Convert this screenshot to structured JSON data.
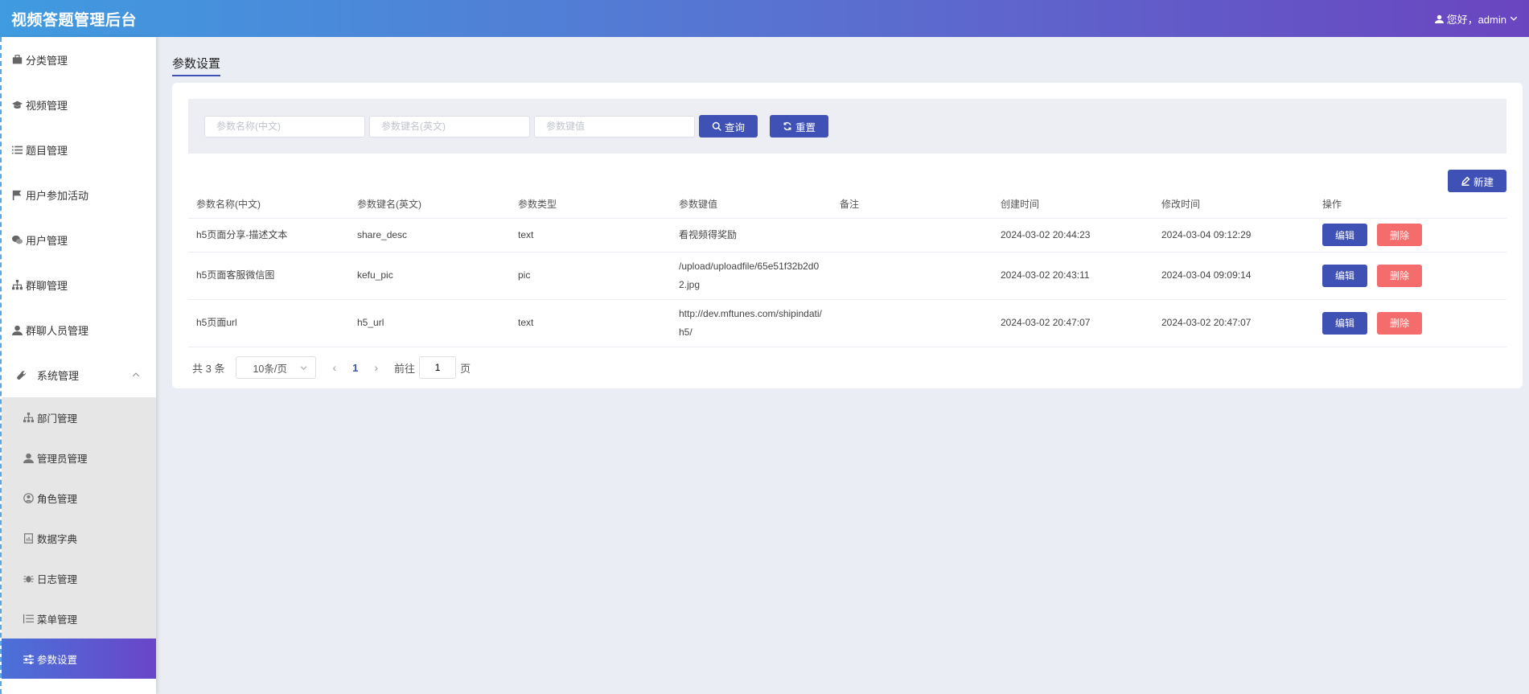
{
  "header": {
    "title": "视频答题管理后台",
    "greeting": "您好，admin"
  },
  "sidebar": {
    "items": [
      {
        "label": "分类管理"
      },
      {
        "label": "视频管理"
      },
      {
        "label": "题目管理"
      },
      {
        "label": "用户参加活动"
      },
      {
        "label": "用户管理"
      },
      {
        "label": "群聊管理"
      },
      {
        "label": "群聊人员管理"
      }
    ],
    "system": {
      "label": "系统管理",
      "children": [
        {
          "label": "部门管理"
        },
        {
          "label": "管理员管理"
        },
        {
          "label": "角色管理"
        },
        {
          "label": "数据字典"
        },
        {
          "label": "日志管理"
        },
        {
          "label": "菜单管理"
        },
        {
          "label": "参数设置"
        }
      ]
    }
  },
  "page": {
    "title": "参数设置"
  },
  "search": {
    "name_placeholder": "参数名称(中文)",
    "key_placeholder": "参数键名(英文)",
    "value_placeholder": "参数键值",
    "search_label": "查询",
    "reset_label": "重置"
  },
  "new_label": "新建",
  "table": {
    "headers": [
      "参数名称(中文)",
      "参数键名(英文)",
      "参数类型",
      "参数键值",
      "备注",
      "创建时间",
      "修改时间",
      "操作"
    ],
    "rows": [
      {
        "name": "h5页面分享-描述文本",
        "key": "share_desc",
        "type": "text",
        "value": "看视频得奖励",
        "remark": "",
        "created": "2024-03-02 20:44:23",
        "modified": "2024-03-04 09:12:29"
      },
      {
        "name": "h5页面客服微信图",
        "key": "kefu_pic",
        "type": "pic",
        "value": "/upload/uploadfile/65e51f32b2d02.jpg",
        "remark": "",
        "created": "2024-03-02 20:43:11",
        "modified": "2024-03-04 09:09:14"
      },
      {
        "name": "h5页面url",
        "key": "h5_url",
        "type": "text",
        "value": "http://dev.mftunes.com/shipindati/h5/",
        "remark": "",
        "created": "2024-03-02 20:47:07",
        "modified": "2024-03-02 20:47:07"
      }
    ],
    "edit_label": "编辑",
    "delete_label": "删除"
  },
  "pagination": {
    "total": "共 3 条",
    "page_size": "10条/页",
    "current": "1",
    "goto_prefix": "前往",
    "goto_value": "1",
    "goto_suffix": "页"
  },
  "colors": {
    "primary": "#3f51b5",
    "danger": "#f56c6c",
    "header_start": "#409be0",
    "header_end": "#6a45c0"
  }
}
